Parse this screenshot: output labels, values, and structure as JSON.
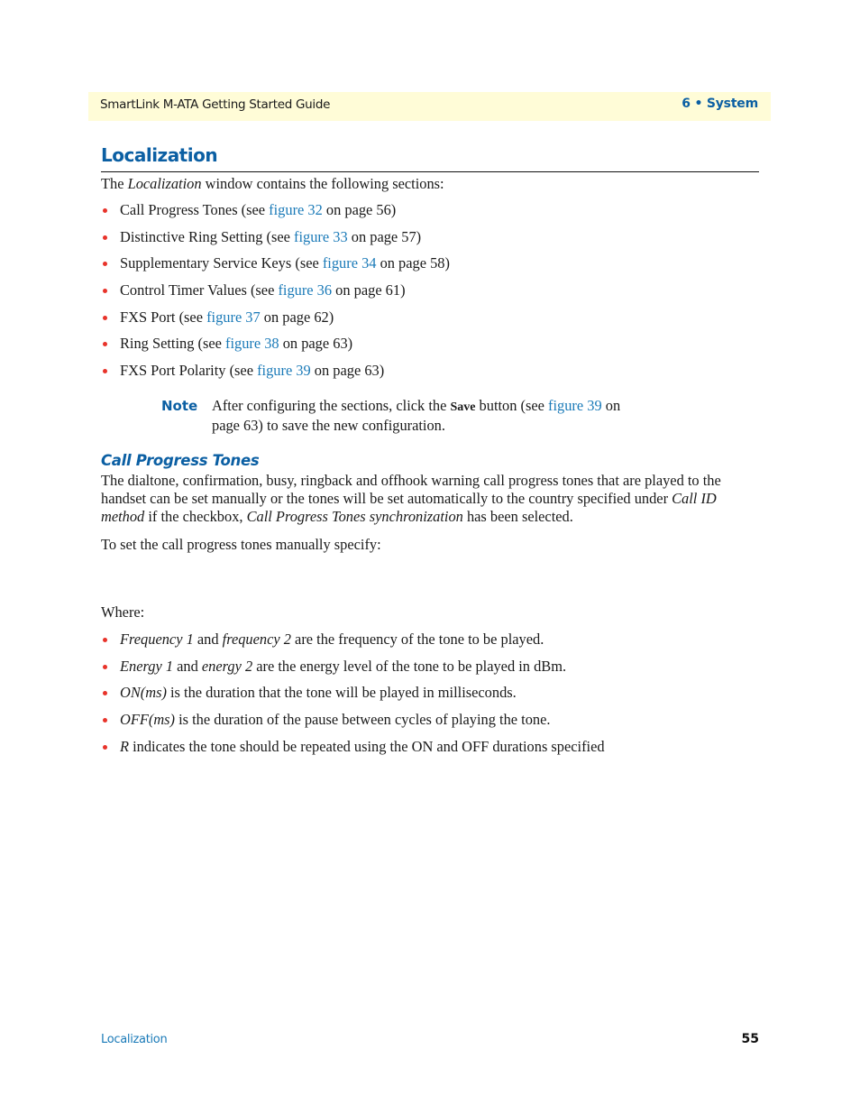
{
  "header": {
    "guide_title": "SmartLink M-ATA Getting Started Guide",
    "chapter": "6 • System"
  },
  "section": {
    "title": "Localization",
    "intro": {
      "before": "The ",
      "italic": "Localization",
      "after": " window contains the following sections:"
    },
    "items": [
      {
        "label": "Call Progress Tones (see ",
        "link": "figure 32",
        "after": " on page 56)"
      },
      {
        "label": "Distinctive Ring Setting (see ",
        "link": "figure 33",
        "after": " on page 57)"
      },
      {
        "label": "Supplementary Service Keys (see ",
        "link": "figure 34",
        "after": " on page 58)"
      },
      {
        "label": "Control Timer Values (see ",
        "link": "figure 36",
        "after": " on page 61)"
      },
      {
        "label": "FXS Port (see ",
        "link": "figure 37",
        "after": " on page 62)"
      },
      {
        "label": "Ring Setting (see ",
        "link": "figure 38",
        "after": " on page 63)"
      },
      {
        "label": "FXS Port Polarity (see ",
        "link": "figure 39",
        "after": " on page 63)"
      }
    ],
    "note": {
      "label": "Note",
      "before": "After configuring the sections, click the ",
      "bold": "Save",
      "middle": " button (see ",
      "link": "figure 39",
      "after": " on page 63) to save the new configuration."
    }
  },
  "subsection": {
    "title": "Call Progress Tones",
    "para1": {
      "a": "The dialtone, confirmation, busy, ringback and offhook warning call progress tones that are played to the handset can be set manually or the tones will be set automatically to the country specified under ",
      "i1": "Call ID method",
      "b": " if the checkbox, ",
      "i2": "Call Progress Tones synchronization",
      "c": " has been selected."
    },
    "para2": "To set the call progress tones manually specify:",
    "where": "Where:",
    "defs": [
      {
        "i1": "Frequency 1",
        "t1": " and ",
        "i2": "frequency 2",
        "t2": " are the frequency of the tone to be played."
      },
      {
        "i1": "Energy 1",
        "t1": " and ",
        "i2": "energy 2",
        "t2": " are the energy level of the tone to be played in dBm."
      },
      {
        "i1": "ON(ms)",
        "t1": " is the duration that the tone will be played in milliseconds.",
        "i2": "",
        "t2": ""
      },
      {
        "i1": "OFF(ms)",
        "t1": " is the duration of the pause between cycles of playing the tone.",
        "i2": "",
        "t2": ""
      },
      {
        "i1": "R",
        "t1": " indicates the tone should be repeated using the ON and OFF durations specified",
        "i2": "",
        "t2": ""
      }
    ]
  },
  "footer": {
    "section_name": "Localization",
    "page_number": "55"
  },
  "colors": {
    "header_band": "#fffcd7",
    "heading_blue": "#0b5fa3",
    "link_blue": "#1a7ab8",
    "bullet_red": "#e8332a"
  }
}
